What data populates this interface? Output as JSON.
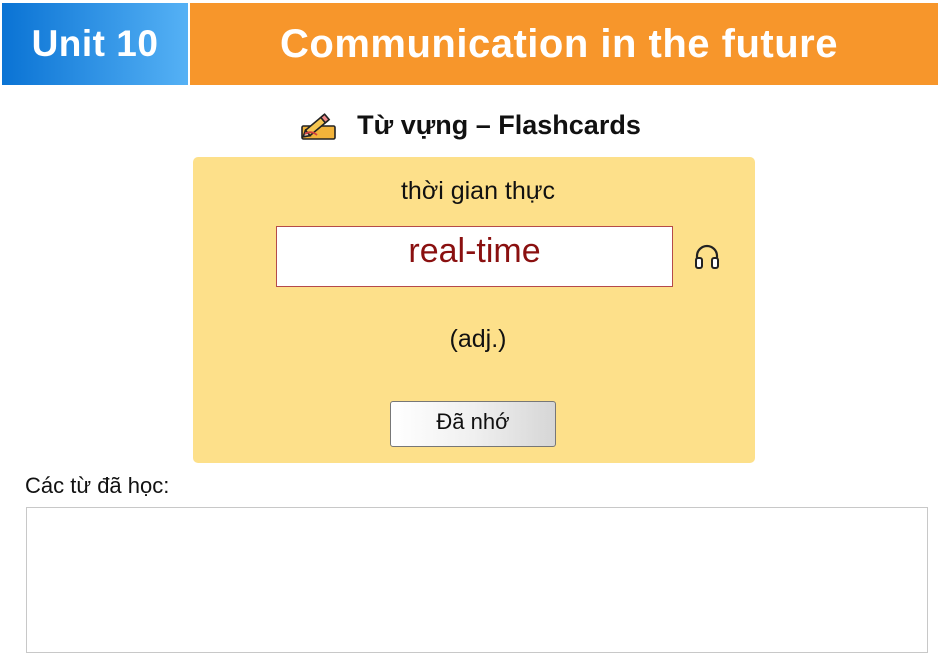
{
  "header": {
    "unit_label": "Unit 10",
    "title": "Communication in the future",
    "unit_colors": [
      "#0a73d4",
      "#55b1f5"
    ],
    "title_color": "#f7962b"
  },
  "section": {
    "icon": "pencil-writing-icon",
    "heading": "Từ vựng – Flashcards"
  },
  "flashcard": {
    "background": "#fde08a",
    "meaning": "thời gian thực",
    "word": "real-time",
    "word_color": "#8a1010",
    "audio_icon": "headphones-icon",
    "part_of_speech": "(adj.)",
    "remember_button": "Đã nhớ"
  },
  "learned": {
    "label": "Các từ đã học:",
    "items": []
  }
}
